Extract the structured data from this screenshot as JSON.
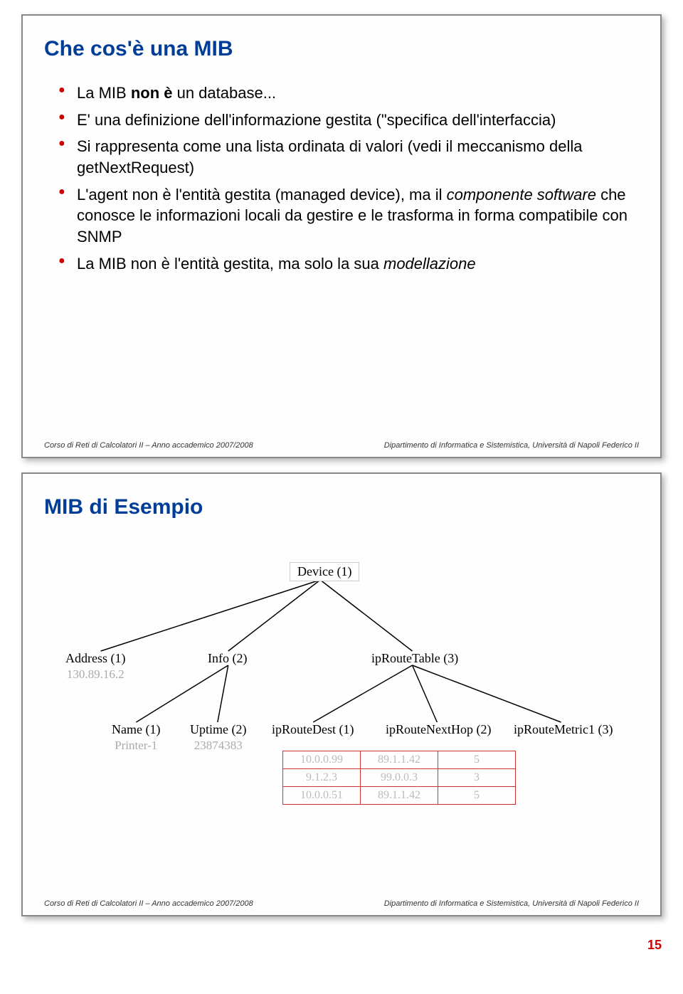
{
  "slide1": {
    "title": "Che cos'è una MIB",
    "bullets": [
      {
        "pre": "La MIB ",
        "bold": "non è",
        "post": " un database..."
      },
      {
        "pre": "E' una definizione dell'informazione gestita (\"specifica dell'interfaccia)",
        "bold": "",
        "post": ""
      },
      {
        "pre": "Si rappresenta come una lista ordinata di valori (vedi il meccanismo della getNextRequest)",
        "bold": "",
        "post": ""
      },
      {
        "pre": "L'agent non è l'entità gestita (managed device), ma il ",
        "italic": "componente software",
        "post": " che conosce le informazioni locali da gestire e le trasforma in forma compatibile con SNMP"
      },
      {
        "pre": "La MIB non è l'entità gestita, ma solo la sua ",
        "italic": "modellazione",
        "post": ""
      }
    ]
  },
  "slide2": {
    "title": "MIB di Esempio",
    "tree": {
      "root": "Device (1)",
      "level1": [
        {
          "label": "Address (1)",
          "val": "130.89.16.2"
        },
        {
          "label": "Info (2)",
          "val": ""
        },
        {
          "label": "ipRouteTable (3)",
          "val": ""
        }
      ],
      "level2": [
        {
          "label": "Name (1)",
          "val": "Printer-1"
        },
        {
          "label": "Uptime (2)",
          "val": "23874383"
        },
        {
          "label": "ipRouteDest (1)",
          "val": ""
        },
        {
          "label": "ipRouteNextHop (2)",
          "val": ""
        },
        {
          "label": "ipRouteMetric1 (3)",
          "val": ""
        }
      ],
      "table": [
        [
          "10.0.0.99",
          "89.1.1.42",
          "5"
        ],
        [
          "9.1.2.3",
          "99.0.0.3",
          "3"
        ],
        [
          "10.0.0.51",
          "89.1.1.42",
          "5"
        ]
      ]
    }
  },
  "footer": {
    "left": "Corso di Reti di Calcolatori II – Anno accademico 2007/2008",
    "right": "Dipartimento di Informatica e Sistemistica, Università di Napoli Federico II"
  },
  "pageNumber": "15"
}
